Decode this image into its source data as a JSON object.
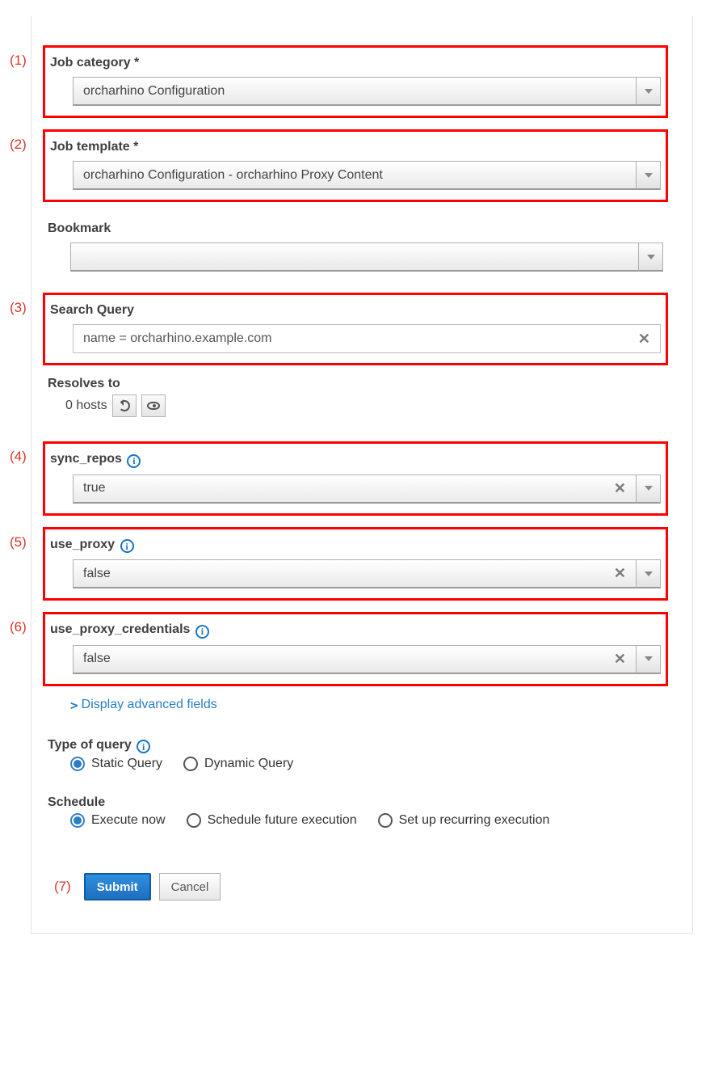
{
  "annotations": {
    "a1": "(1)",
    "a2": "(2)",
    "a3": "(3)",
    "a4": "(4)",
    "a5": "(5)",
    "a6": "(6)",
    "a7": "(7)"
  },
  "job_category": {
    "label": "Job category *",
    "value": "orcharhino Configuration"
  },
  "job_template": {
    "label": "Job template *",
    "value": "orcharhino Configuration - orcharhino Proxy Content"
  },
  "bookmark": {
    "label": "Bookmark",
    "value": ""
  },
  "search_query": {
    "label": "Search Query",
    "value": "name = orcharhino.example.com"
  },
  "resolves": {
    "label": "Resolves to",
    "text": "0 hosts"
  },
  "sync_repos": {
    "label": "sync_repos",
    "value": "true"
  },
  "use_proxy": {
    "label": "use_proxy",
    "value": "false"
  },
  "use_proxy_credentials": {
    "label": "use_proxy_credentials",
    "value": "false"
  },
  "advanced": {
    "label": "Display advanced fields"
  },
  "type_of_query": {
    "label": "Type of query",
    "options": [
      "Static Query",
      "Dynamic Query"
    ],
    "selected": "Static Query"
  },
  "schedule": {
    "label": "Schedule",
    "options": [
      "Execute now",
      "Schedule future execution",
      "Set up recurring execution"
    ],
    "selected": "Execute now"
  },
  "buttons": {
    "submit": "Submit",
    "cancel": "Cancel"
  }
}
